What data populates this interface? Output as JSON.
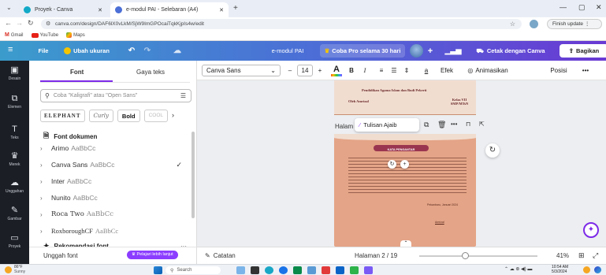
{
  "browser": {
    "tabs": [
      {
        "label": "Proyek - Canva",
        "active": false
      },
      {
        "label": "e-modul PAI - Selebaran (A4)",
        "active": true
      }
    ],
    "new_tab": "+",
    "url": "canva.com/design/DAF6lX0vLkM/SjW9ImGPOcaiTqkKjpIs4w/edit",
    "finish_update": "Finish update",
    "bookmarks": [
      "Gmail",
      "YouTube",
      "Maps"
    ]
  },
  "topbar": {
    "file": "File",
    "resize": "Ubah ukuran",
    "doc_title": "e-modul PAI",
    "try_pro": "Coba Pro selama 30 hari",
    "print": "Cetak dengan Canva",
    "share": "Bagikan"
  },
  "rail": {
    "items": [
      "Desain",
      "Elemen",
      "Teks",
      "Merek",
      "Unggahan",
      "Gambar",
      "Proyek"
    ]
  },
  "panel": {
    "tab_font": "Font",
    "tab_style": "Gaya teks",
    "search_placeholder": "Coba \"Kaligrafi\" atau \"Open Sans\"",
    "style_chips": [
      "ELEPHANT",
      "Curly",
      "Bold",
      "COOL"
    ],
    "section_doc": "Font dokumen",
    "fonts": [
      {
        "name": "Arimo",
        "sample": "AaBbCc",
        "selected": false
      },
      {
        "name": "Canva Sans",
        "sample": "AaBbCc",
        "selected": true
      },
      {
        "name": "Inter",
        "sample": "AaBbCc",
        "selected": false
      },
      {
        "name": "Nunito",
        "sample": "AaBbCc",
        "selected": false
      },
      {
        "name": "Roca Two",
        "sample": "AaBbCc",
        "selected": false
      },
      {
        "name": "RoxboroughCF",
        "sample": "AaBbCc",
        "selected": false
      }
    ],
    "section_reco": "Rekomendasi font",
    "upload_font": "Unggah font",
    "learn_more": "Pelajari lebih lanjut"
  },
  "toolbar": {
    "font_name": "Canva Sans",
    "font_size": "14",
    "minus": "–",
    "plus": "+",
    "effects": "Efek",
    "animate": "Animasikan",
    "position": "Posisi",
    "more": "•••"
  },
  "canvas": {
    "page_title_text": "Halam",
    "magic_write": "Tulisan Ajaib",
    "doc_heading": "Pendidikan Agama Islam dan Budi Pekerti",
    "doc_author": "Oleh Amrizal",
    "doc_class": "Kelas VII SMP/MTsN",
    "doc_banner": "KATA PENGANTAR",
    "doc_date": "Pekanbaru, Januari 2024",
    "doc_sign": "Amrizal"
  },
  "bottom": {
    "notes": "Catatan",
    "page": "Halaman 2 / 19",
    "zoom": "41%"
  },
  "taskbar": {
    "weather_temp": "86°F",
    "weather_desc": "Sunny",
    "search": "Search",
    "time": "10:54 AM",
    "date": "5/3/2024"
  },
  "colors": {
    "page_bg": "#e4a487",
    "page_header": "#f1ddd0",
    "banner": "#9a3550"
  }
}
